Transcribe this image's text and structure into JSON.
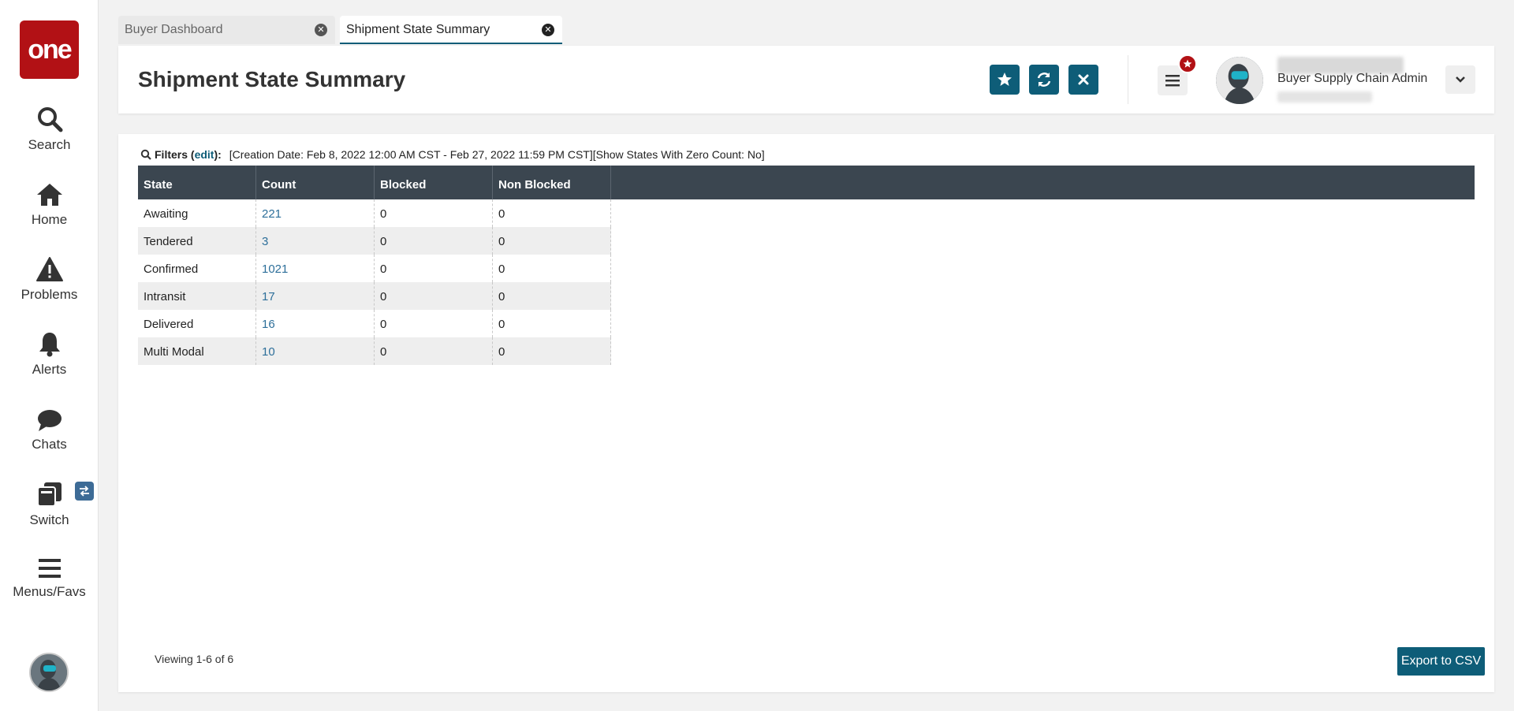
{
  "sidebar": {
    "logo_text": "one",
    "items": [
      {
        "label": "Search",
        "icon": "search-icon"
      },
      {
        "label": "Home",
        "icon": "home-icon"
      },
      {
        "label": "Problems",
        "icon": "warning-icon"
      },
      {
        "label": "Alerts",
        "icon": "bell-icon"
      },
      {
        "label": "Chats",
        "icon": "chat-icon"
      },
      {
        "label": "Switch",
        "icon": "switch-icon"
      },
      {
        "label": "Menus/Favs",
        "icon": "hamburger-icon"
      }
    ]
  },
  "tabs": [
    {
      "label": "Buyer Dashboard",
      "active": false
    },
    {
      "label": "Shipment State Summary",
      "active": true
    }
  ],
  "header": {
    "title": "Shipment State Summary",
    "user_role": "Buyer Supply Chain Admin"
  },
  "filters": {
    "label": "Filters",
    "edit_label": "edit",
    "text": "[Creation Date: Feb 8, 2022 12:00 AM CST - Feb 27, 2022 11:59 PM CST][Show States With Zero Count: No]"
  },
  "table": {
    "columns": [
      "State",
      "Count",
      "Blocked",
      "Non Blocked"
    ],
    "rows": [
      {
        "state": "Awaiting",
        "count": "221",
        "blocked": "0",
        "non_blocked": "0"
      },
      {
        "state": "Tendered",
        "count": "3",
        "blocked": "0",
        "non_blocked": "0"
      },
      {
        "state": "Confirmed",
        "count": "1021",
        "blocked": "0",
        "non_blocked": "0"
      },
      {
        "state": "Intransit",
        "count": "17",
        "blocked": "0",
        "non_blocked": "0"
      },
      {
        "state": "Delivered",
        "count": "16",
        "blocked": "0",
        "non_blocked": "0"
      },
      {
        "state": "Multi Modal",
        "count": "10",
        "blocked": "0",
        "non_blocked": "0"
      }
    ]
  },
  "footer": {
    "viewing": "Viewing 1-6 of 6",
    "export_label": "Export to CSV"
  },
  "colors": {
    "brand_red": "#b21115",
    "accent_teal": "#0e5d78",
    "header_dark": "#3b4650",
    "link_blue": "#2d6f9a"
  }
}
